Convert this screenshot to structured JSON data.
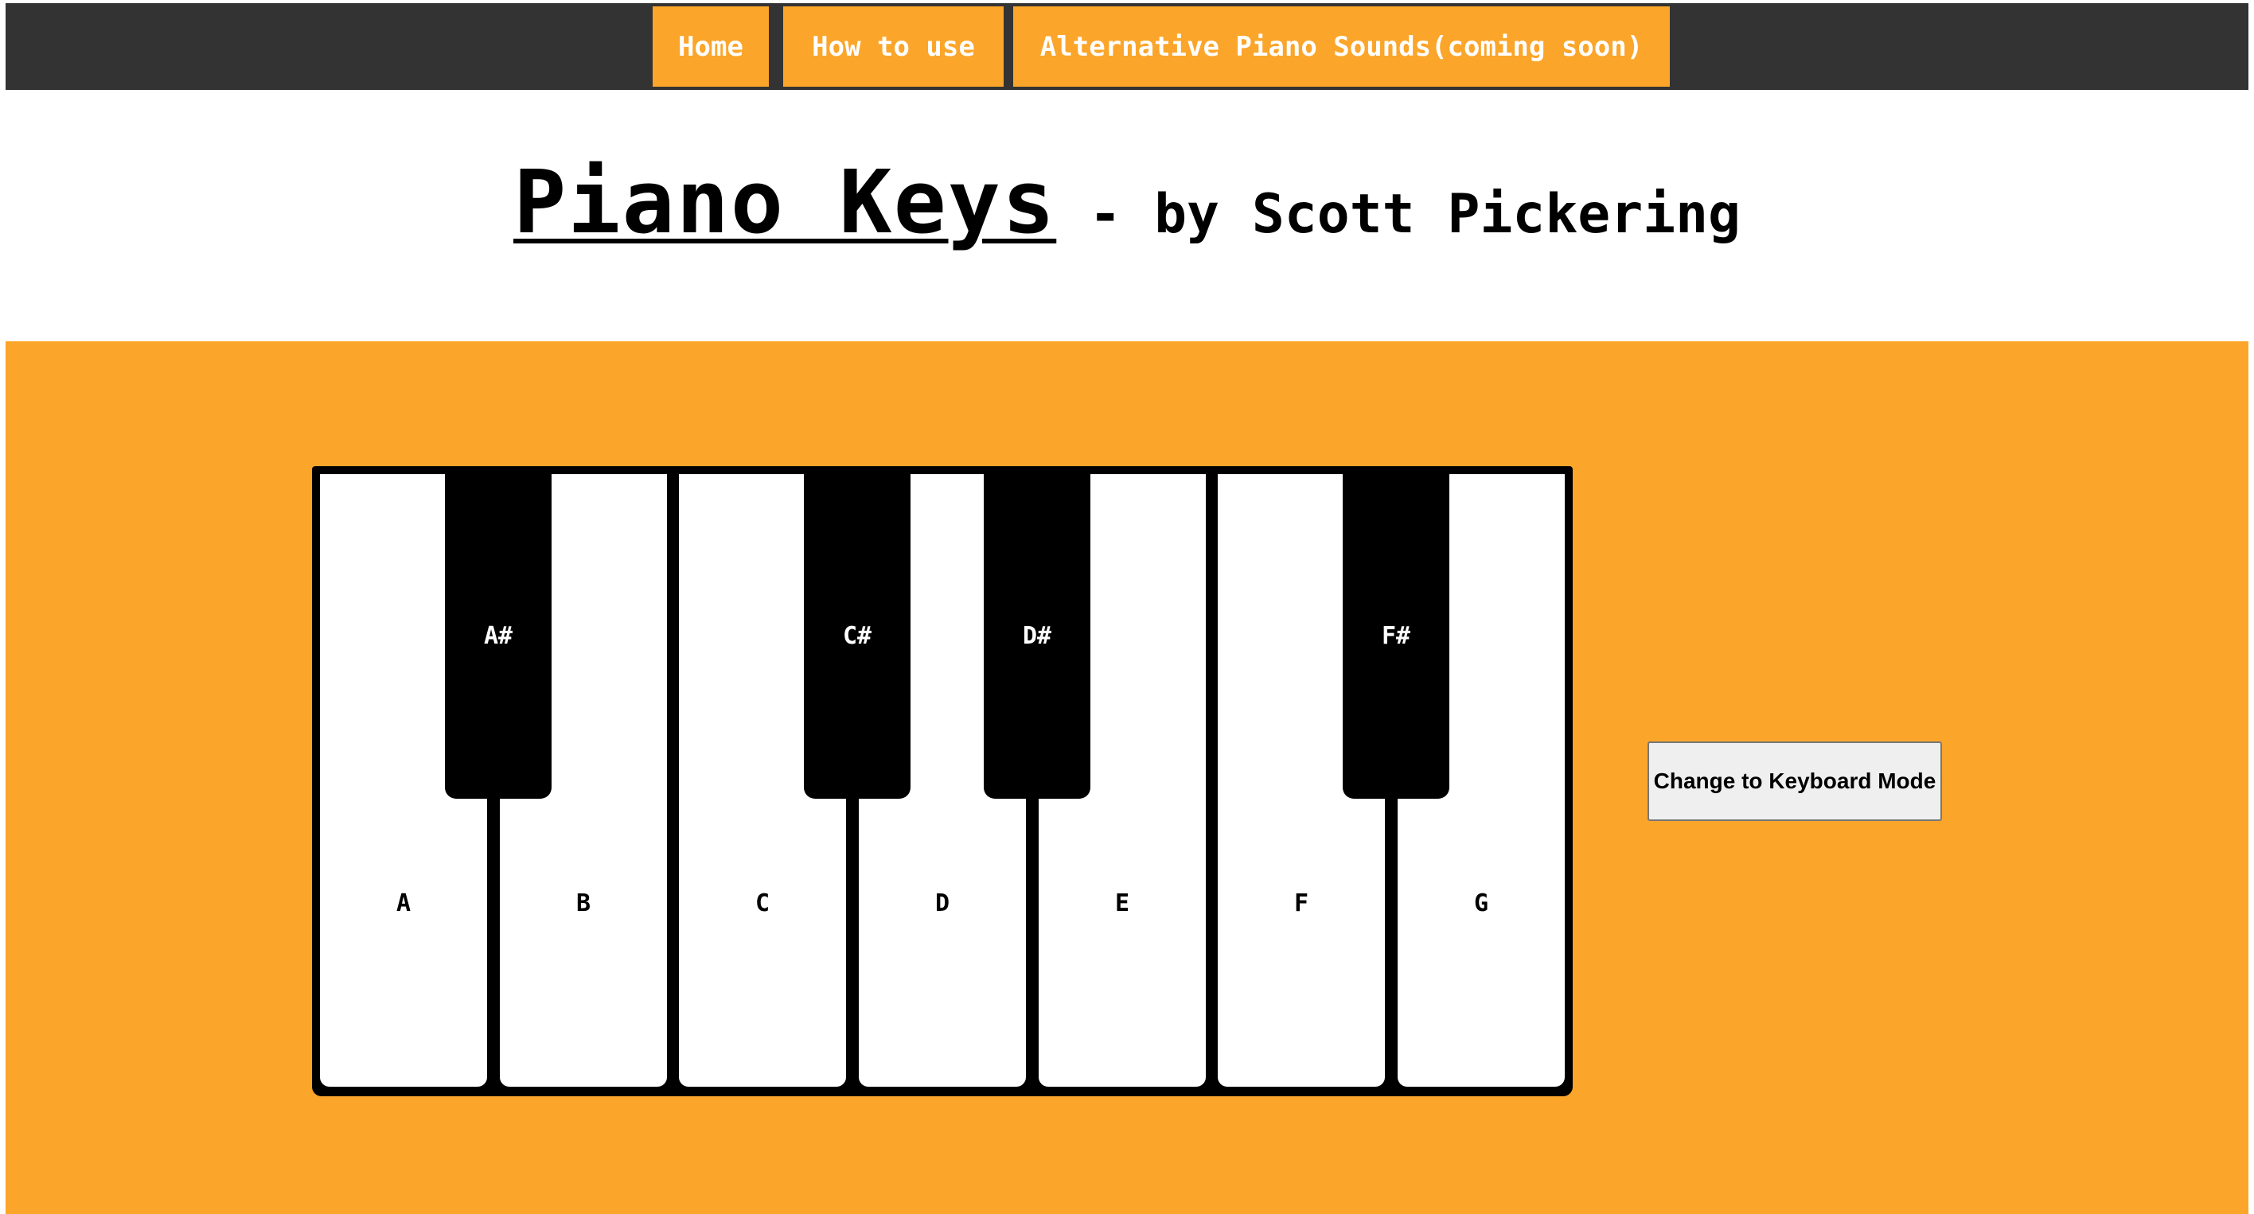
{
  "nav": {
    "items": [
      {
        "label": "Home"
      },
      {
        "label": "How to use"
      },
      {
        "label": "Alternative Piano Sounds(coming soon)"
      }
    ]
  },
  "header": {
    "title": "Piano Keys",
    "subtitle": " - by Scott Pickering"
  },
  "piano": {
    "white_keys": [
      "A",
      "B",
      "C",
      "D",
      "E",
      "F",
      "G"
    ],
    "black_keys": [
      "A#",
      "C#",
      "D#",
      "F#"
    ]
  },
  "controls": {
    "mode_button_label": "Change to Keyboard Mode"
  },
  "colors": {
    "accent": "#fba52a",
    "nav_background": "#333333",
    "key_white": "#ffffff",
    "key_black": "#000000"
  }
}
